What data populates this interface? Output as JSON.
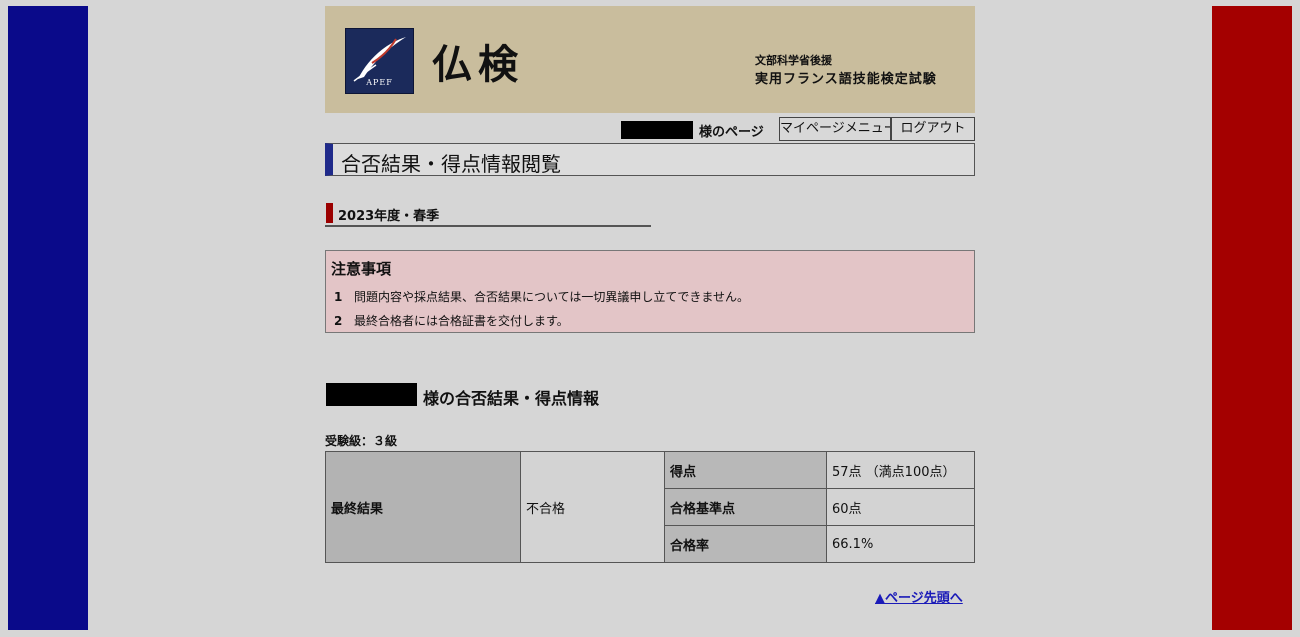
{
  "colors": {
    "flag_left": "#0a0a8a",
    "flag_right": "#a40000",
    "header_bg": "#c9bd9d",
    "notice_bg": "#e3c5c7"
  },
  "header": {
    "logo_text": "APEF",
    "brand": "仏検",
    "subtitle_line1": "文部科学省後援",
    "subtitle_line2": "実用フランス語技能検定試験"
  },
  "userbar": {
    "suffix": "様のページ",
    "mypage_label": "マイページメニュー",
    "logout_label": "ログアウト"
  },
  "page_title": "合否結果・得点情報閲覧",
  "term": "2023年度・春季",
  "notice": {
    "title": "注意事項",
    "items": [
      {
        "num": "1",
        "text": "問題内容や採点結果、合否結果については一切異議申し立てできません。"
      },
      {
        "num": "2",
        "text": "最終合格者には合格証書を交付します。"
      }
    ]
  },
  "result_heading": "様の合否結果・得点情報",
  "grade_label": "受験級：３級",
  "result_table": {
    "final_label": "最終結果",
    "final_value": "不合格",
    "rows": [
      {
        "label": "得点",
        "value": "57点 （満点100点）"
      },
      {
        "label": "合格基準点",
        "value": "60点"
      },
      {
        "label": "合格率",
        "value": "66.1%"
      }
    ]
  },
  "top_link": "▲ページ先頭へ"
}
